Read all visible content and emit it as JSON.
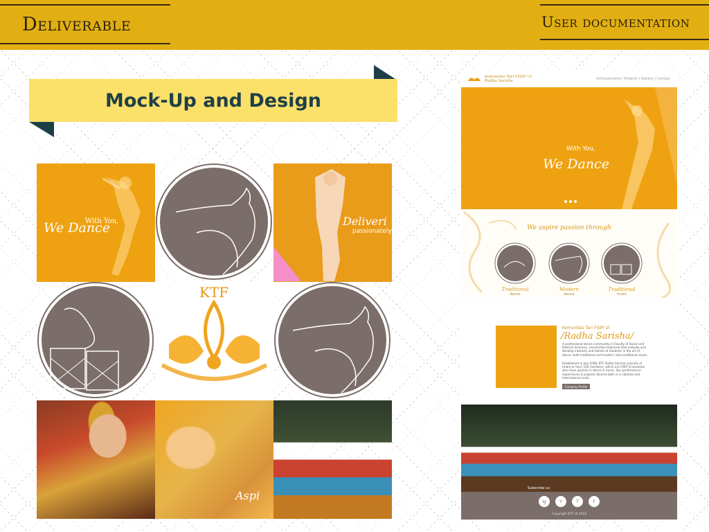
{
  "header": {
    "left_title": "Deliverable",
    "right_title": "User documentation"
  },
  "ribbon": {
    "title": "Mock-Up and Design"
  },
  "grid": {
    "tile1": {
      "sub": "With You,",
      "title": "We Dance"
    },
    "tile3": {
      "title": "Deliveri",
      "sub": "passionately"
    },
    "tile5": {
      "text": "KTF"
    },
    "tile8": {
      "text": "Aspi"
    }
  },
  "mockup": {
    "brand_line1": "Komunitas Tari FISIP UI",
    "brand_line2": "Radha Sarisha",
    "nav_links": "Achievements  |  Projects  |  Gallery  |  Contact",
    "hero_sub": "With You,",
    "hero_title": "We Dance",
    "aspire_title": "We aspire passion through",
    "aspire_items": [
      {
        "label": "Traditional",
        "sub": "dance"
      },
      {
        "label": "Modern",
        "sub": "dance"
      },
      {
        "label": "Traditional",
        "sub": "music"
      }
    ],
    "about_small": "Komunitas Tari FISIP UI",
    "about_title": "/Radha Sarisha/",
    "about_p1": "A professional dance community in Faculty of Social and Political Sciences, Universitas Indonesia that embody and develop interests and talents of students in the art of dance, both traditional and modern; also traditional music.",
    "about_p2": "Established in July 2008, KTF Radha Sarisha consists of (more or less) 100 members, which are FISIP UI students who have passion in dance & music. Our performance experiences & projects diverse both in a national and international scale.",
    "about_button": "Company Profile",
    "subscribe_label": "Subscribe us",
    "social": [
      "Ig",
      "Y",
      "T",
      "F"
    ],
    "copyright": "Copyright KTF UI 2016"
  },
  "colors": {
    "header": "#e1af12",
    "ribbon": "#fbe06a",
    "ribbon_text": "#1f3f47",
    "orange": "#efa211",
    "circle_fill": "#7b6d69"
  }
}
